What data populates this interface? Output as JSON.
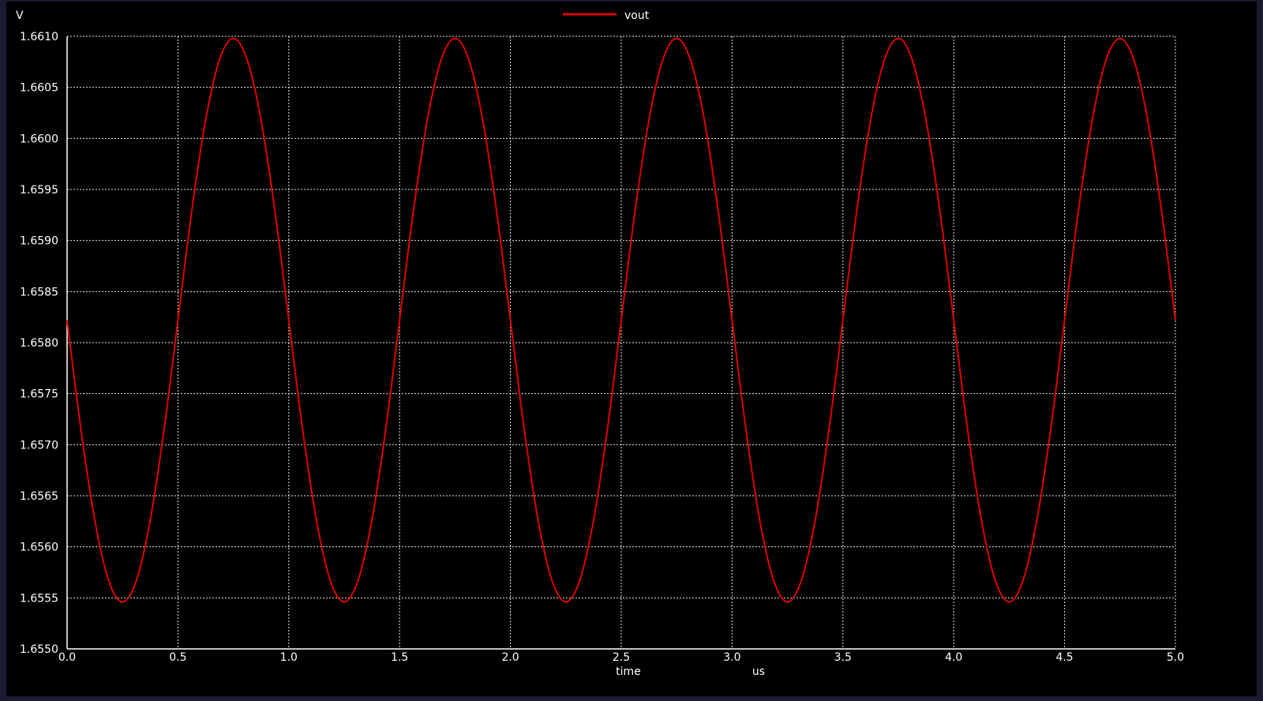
{
  "chart_data": {
    "type": "line",
    "ylabel": "V",
    "xlabel": "time",
    "xunit": "us",
    "xlim": [
      0.0,
      5.0
    ],
    "ylim": [
      1.655,
      1.661
    ],
    "xticks": [
      "0.0",
      "0.5",
      "1.0",
      "1.5",
      "2.0",
      "2.5",
      "3.0",
      "3.5",
      "4.0",
      "4.5",
      "5.0"
    ],
    "yticks": [
      "1.6550",
      "1.6555",
      "1.6560",
      "1.6565",
      "1.6570",
      "1.6575",
      "1.6580",
      "1.6585",
      "1.6590",
      "1.6595",
      "1.6600",
      "1.6605",
      "1.6610"
    ],
    "grid": true,
    "legend_position": "top-center",
    "series": [
      {
        "name": "vout",
        "color": "#e00000",
        "x": [
          0.0,
          0.0625,
          0.125,
          0.1875,
          0.25,
          0.3125,
          0.375,
          0.4375,
          0.5,
          0.5625,
          0.625,
          0.6875,
          0.75,
          0.8125,
          0.875,
          0.9375,
          1.0,
          1.0625,
          1.125,
          1.1875,
          1.25,
          1.3125,
          1.375,
          1.4375,
          1.5,
          1.5625,
          1.625,
          1.6875,
          1.75,
          1.8125,
          1.875,
          1.9375,
          2.0,
          2.0625,
          2.125,
          2.1875,
          2.25,
          2.3125,
          2.375,
          2.4375,
          2.5,
          2.5625,
          2.625,
          2.6875,
          2.75,
          2.8125,
          2.875,
          2.9375,
          3.0,
          3.0625,
          3.125,
          3.1875,
          3.25,
          3.3125,
          3.375,
          3.4375,
          3.5,
          3.5625,
          3.625,
          3.6875,
          3.75,
          3.8125,
          3.875,
          3.9375,
          4.0,
          4.0625,
          4.125,
          4.1875,
          4.25,
          4.3125,
          4.375,
          4.4375,
          4.5,
          4.5625,
          4.625,
          4.6875,
          4.75,
          4.8125,
          4.875,
          4.9375,
          5.0
        ],
        "y": [
          1.65822,
          1.65715,
          1.65626,
          1.65567,
          1.65546,
          1.65567,
          1.65626,
          1.65715,
          1.65822,
          1.65929,
          1.66018,
          1.66077,
          1.66098,
          1.66077,
          1.66018,
          1.65929,
          1.65822,
          1.65715,
          1.65626,
          1.65567,
          1.65546,
          1.65567,
          1.65626,
          1.65715,
          1.65822,
          1.65929,
          1.66018,
          1.66077,
          1.66098,
          1.66077,
          1.66018,
          1.65929,
          1.65822,
          1.65715,
          1.65626,
          1.65567,
          1.65546,
          1.65567,
          1.65626,
          1.65715,
          1.65822,
          1.65929,
          1.66018,
          1.66077,
          1.66098,
          1.66077,
          1.66018,
          1.65929,
          1.65822,
          1.65715,
          1.65626,
          1.65567,
          1.65546,
          1.65567,
          1.65626,
          1.65715,
          1.65822,
          1.65929,
          1.66018,
          1.66077,
          1.66098,
          1.66077,
          1.66018,
          1.65929,
          1.65822,
          1.65715,
          1.65626,
          1.65567,
          1.65546,
          1.65567,
          1.65626,
          1.65715,
          1.65822,
          1.65929,
          1.66018,
          1.66077,
          1.66098,
          1.66077,
          1.66018,
          1.65929,
          1.65822
        ]
      }
    ]
  }
}
